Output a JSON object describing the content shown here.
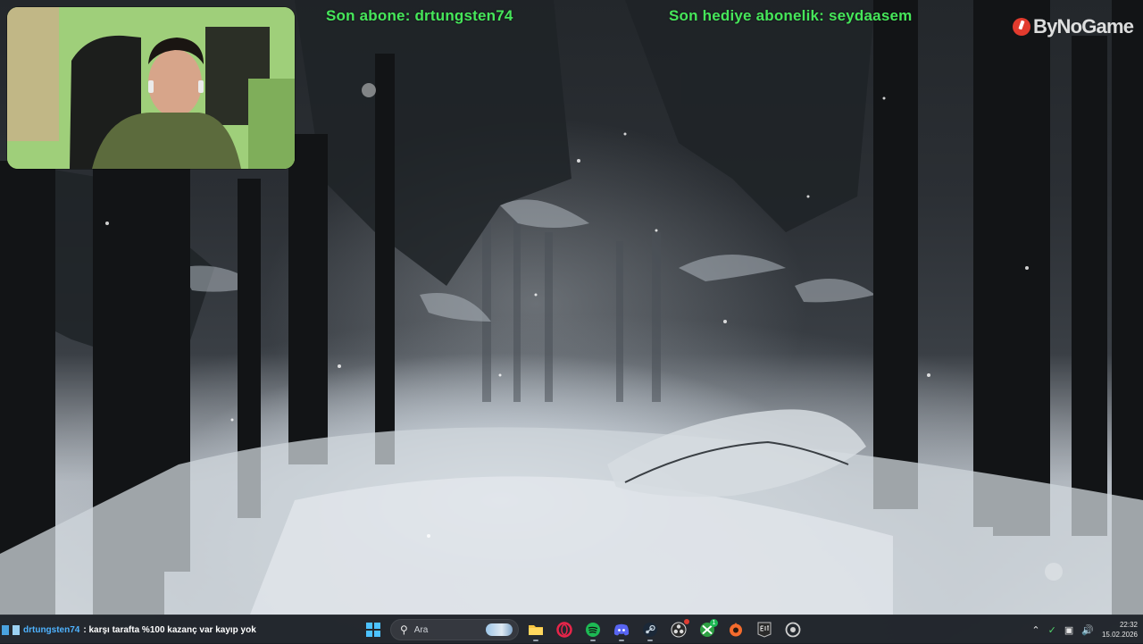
{
  "overlay": {
    "last_subscriber": "Son abone: drtungsten74",
    "last_gift_sub": "Son hediye abonelik: seydaasem"
  },
  "brand": {
    "logo_text": "ByNoGame"
  },
  "chat_ticker": {
    "username": "drtungsten74",
    "message": ": karşı tarafta %100 kazanç var kayıp yok"
  },
  "taskbar": {
    "search_placeholder": "Ara",
    "apps": [
      {
        "name": "file-explorer",
        "icon": "folder-icon",
        "color": "#f4c341"
      },
      {
        "name": "opera-gx",
        "icon": "opera-icon",
        "color": "#e8254a"
      },
      {
        "name": "spotify",
        "icon": "spotify-icon",
        "color": "#1db954"
      },
      {
        "name": "discord",
        "icon": "discord-icon",
        "color": "#5865f2"
      },
      {
        "name": "steam",
        "icon": "steam-icon",
        "color": "#c7d5e0"
      },
      {
        "name": "obs",
        "icon": "obs-icon",
        "color": "#dcdcdc"
      },
      {
        "name": "xbox",
        "icon": "xbox-icon",
        "color": "#2ea043",
        "badge": "1"
      },
      {
        "name": "origin",
        "icon": "origin-icon",
        "color": "#f56c2d"
      },
      {
        "name": "epic-games",
        "icon": "epic-icon",
        "color": "#2a2a2a"
      },
      {
        "name": "chrome-like",
        "icon": "browser-icon",
        "color": "#cfcfcf"
      }
    ]
  },
  "clock": {
    "time": "22:32",
    "date": "15.02.2026"
  }
}
